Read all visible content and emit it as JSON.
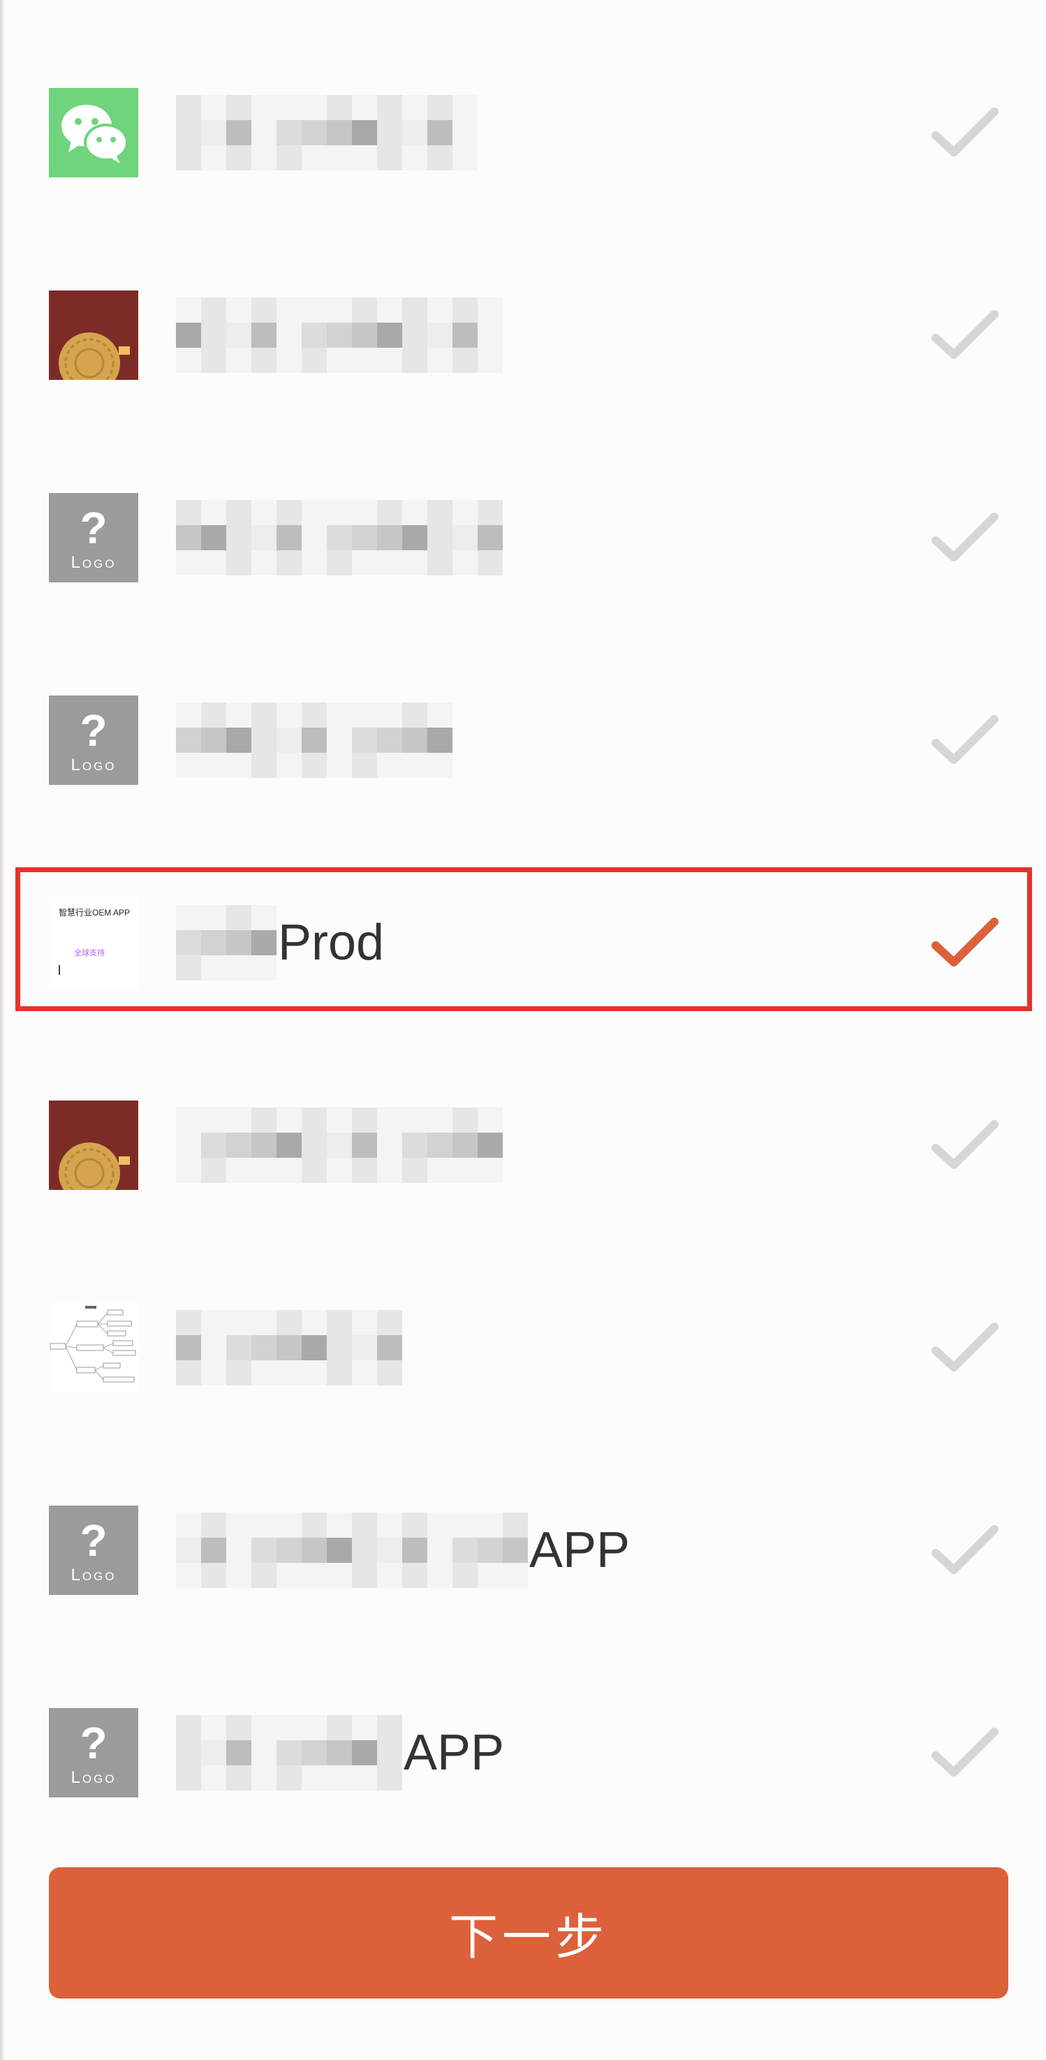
{
  "app_list": {
    "items": [
      {
        "icon": "wechat-icon",
        "name_suffix": "",
        "mosaic_cols": 12,
        "selected": false
      },
      {
        "icon": "mooncake-icon",
        "name_suffix": "",
        "mosaic_cols": 13,
        "selected": false
      },
      {
        "icon": "logo-placeholder-icon",
        "name_suffix": "",
        "mosaic_cols": 13,
        "selected": false
      },
      {
        "icon": "logo-placeholder-icon",
        "name_suffix": "",
        "mosaic_cols": 11,
        "selected": false
      },
      {
        "icon": "oem-app-icon",
        "name_suffix": "Prod",
        "mosaic_cols": 4,
        "selected": true
      },
      {
        "icon": "mooncake-icon",
        "name_suffix": "",
        "mosaic_cols": 13,
        "selected": false
      },
      {
        "icon": "mindmap-icon",
        "name_suffix": "",
        "mosaic_cols": 9,
        "selected": false
      },
      {
        "icon": "logo-placeholder-icon",
        "name_suffix": "APP",
        "mosaic_cols": 14,
        "selected": false
      },
      {
        "icon": "logo-placeholder-icon",
        "name_suffix": "APP",
        "mosaic_cols": 9,
        "selected": false
      }
    ]
  },
  "icons": {
    "placeholder_mark": "?",
    "placeholder_text": "Logo",
    "oem_title": "智慧行业OEM APP",
    "oem_subtitle": "全球支持"
  },
  "colors": {
    "accent": "#dc613a",
    "check_inactive": "#d6d6d6",
    "selection_frame": "#e6322b",
    "wechat_green": "#6fd47c",
    "mooncake_bg": "#7d2b27"
  },
  "footer": {
    "next_label": "下一步"
  }
}
